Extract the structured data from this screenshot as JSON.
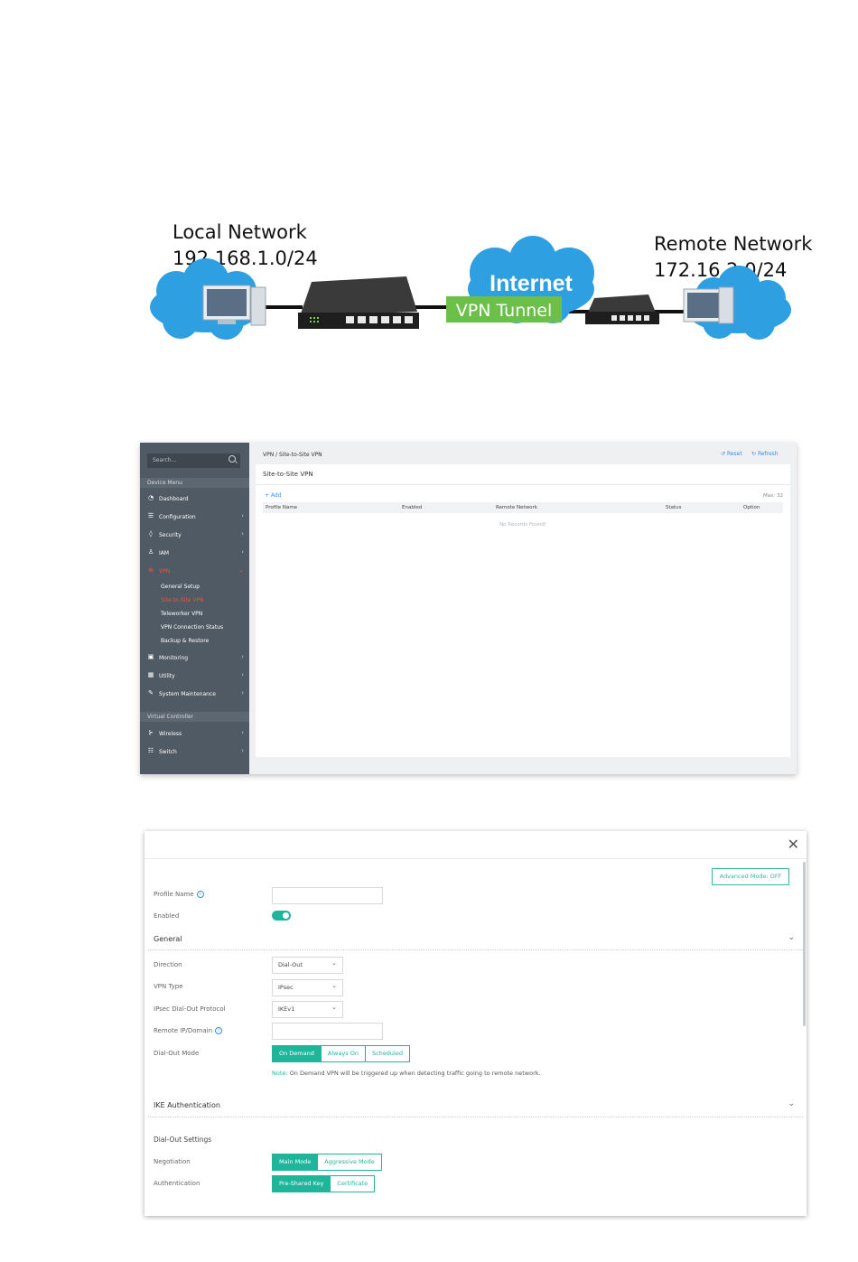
{
  "topology": {
    "local_title": "Local Network",
    "local_subnet": "192.168.1.0/24",
    "internet_label": "Internet",
    "tunnel_label": "VPN Tunnel",
    "remote_title": "Remote Network",
    "remote_subnet": "172.16.2.0/24",
    "colors": {
      "cloud": "#2e9fe0",
      "tunnel": "#6cc04a",
      "router": "#2b2b2b"
    }
  },
  "list_page": {
    "search_placeholder": "Search...",
    "device_menu_header": "Device Menu",
    "menu": [
      {
        "label": "Dashboard",
        "icon": "dashboard-icon"
      },
      {
        "label": "Configuration",
        "icon": "sliders-icon"
      },
      {
        "label": "Security",
        "icon": "shield-icon"
      },
      {
        "label": "IAM",
        "icon": "user-lock-icon"
      },
      {
        "label": "VPN",
        "icon": "vpn-lock-icon"
      }
    ],
    "vpn_submenu": [
      "General Setup",
      "Site-to-Site VPN",
      "Teleworker VPN",
      "VPN Connection Status",
      "Backup & Restore"
    ],
    "menu_after": [
      {
        "label": "Monitoring",
        "icon": "monitor-icon"
      },
      {
        "label": "Utility",
        "icon": "grid-icon"
      },
      {
        "label": "System Maintenance",
        "icon": "wrench-icon"
      }
    ],
    "virtual_controller_header": "Virtual Controller",
    "vc_menu": [
      {
        "label": "Wireless",
        "icon": "wireless-icon"
      },
      {
        "label": "Switch",
        "icon": "switch-icon"
      }
    ],
    "breadcrumb": "VPN / Site-to-Site VPN",
    "reset_label": "Reset",
    "refresh_label": "Refresh",
    "panel_title": "Site-to-Site VPN",
    "add_label": "+ Add",
    "max_label": "Max: 32",
    "columns": [
      "Profile Name",
      "Enabled",
      "Remote Network",
      "Status",
      "Option"
    ],
    "empty_text": "No Records Found!",
    "accent": "#e8563b",
    "link_color": "#3a8ee6"
  },
  "dialog": {
    "advanced_mode": "Advanced Mode: OFF",
    "profile_name_label": "Profile Name",
    "profile_name_value": "",
    "enabled_label": "Enabled",
    "enabled": true,
    "general_title": "General",
    "direction_label": "Direction",
    "direction_value": "Dial-Out",
    "vpn_type_label": "VPN Type",
    "vpn_type_value": "IPsec",
    "protocol_label": "IPsec Dial-Out Protocol",
    "protocol_value": "IKEv1",
    "remote_label": "Remote IP/Domain",
    "remote_value": "",
    "dialout_mode_label": "Dial-Out Mode",
    "dialout_modes": [
      "On Demand",
      "Always On",
      "Scheduled"
    ],
    "dialout_selected": "On Demand",
    "note_prefix": "Note:",
    "note_text": "On Demand VPN will be triggered up when detecting traffic going to remote network.",
    "ike_title": "IKE Authentication",
    "dialout_settings_title": "Dial-Out Settings",
    "negotiation_label": "Negotiation",
    "negotiation_modes": [
      "Main Mode",
      "Aggressive Mode"
    ],
    "negotiation_selected": "Main Mode",
    "authentication_label": "Authentication",
    "authentication_modes": [
      "Pre-Shared Key",
      "Certificate"
    ],
    "authentication_selected": "Pre-Shared Key",
    "accent": "#1fb59b"
  }
}
